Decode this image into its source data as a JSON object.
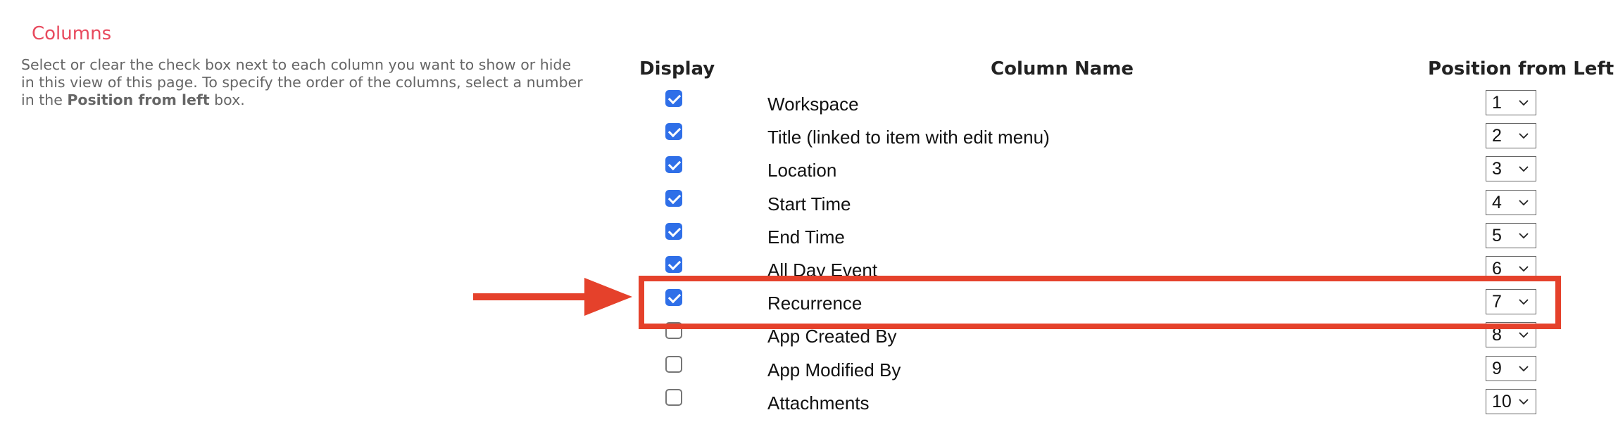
{
  "section": {
    "title": "Columns",
    "description_part1": "Select or clear the check box next to each column you want to show or hide in this view of this page. To specify the order of the columns, select a number in the ",
    "description_bold": "Position from left",
    "description_part2": " box."
  },
  "table": {
    "headers": {
      "display": "Display",
      "column_name": "Column Name",
      "position": "Position from Left"
    },
    "rows": [
      {
        "name": "Workspace",
        "checked": true,
        "position": "1"
      },
      {
        "name": "Title (linked to item with edit menu)",
        "checked": true,
        "position": "2"
      },
      {
        "name": "Location",
        "checked": true,
        "position": "3"
      },
      {
        "name": "Start Time",
        "checked": true,
        "position": "4"
      },
      {
        "name": "End Time",
        "checked": true,
        "position": "5"
      },
      {
        "name": "All Day Event",
        "checked": true,
        "position": "6"
      },
      {
        "name": "Recurrence",
        "checked": true,
        "position": "7"
      },
      {
        "name": "App Created By",
        "checked": false,
        "position": "8"
      },
      {
        "name": "App Modified By",
        "checked": false,
        "position": "9"
      },
      {
        "name": "Attachments",
        "checked": false,
        "position": "10"
      }
    ]
  },
  "annotation": {
    "highlighted_row": "Recurrence",
    "color": "#e5412b"
  },
  "colors": {
    "title": "#e8495d",
    "checkbox": "#2f6fe8"
  }
}
